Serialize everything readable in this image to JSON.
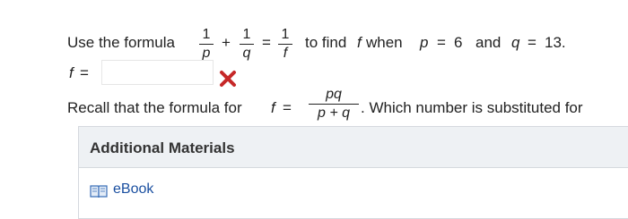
{
  "question": {
    "prefix": "Use the formula",
    "formula_one": "1",
    "formula_p": "p",
    "plus": "+",
    "formula_q": "q",
    "equals": "=",
    "formula_f": "f",
    "instruction": "to find",
    "var_f": "f",
    "when": "when",
    "var_p": "p",
    "eq_sign": "=",
    "p_value": "6",
    "and": "and",
    "var_q": "q",
    "q_value": "13."
  },
  "answer_row": {
    "label_var": "f",
    "label_eq": "=",
    "value": "",
    "status_icon": "x-mark-icon",
    "status_color": "#c62828"
  },
  "recall": {
    "prefix": "Recall that the formula for",
    "var_f": "f",
    "eq": "=",
    "numerator": "pq",
    "denominator": "p + q",
    "suffix": ". Which number is substituted for"
  },
  "additional_materials": {
    "title": "Additional Materials",
    "link_label": "eBook",
    "link_icon": "book-icon"
  }
}
